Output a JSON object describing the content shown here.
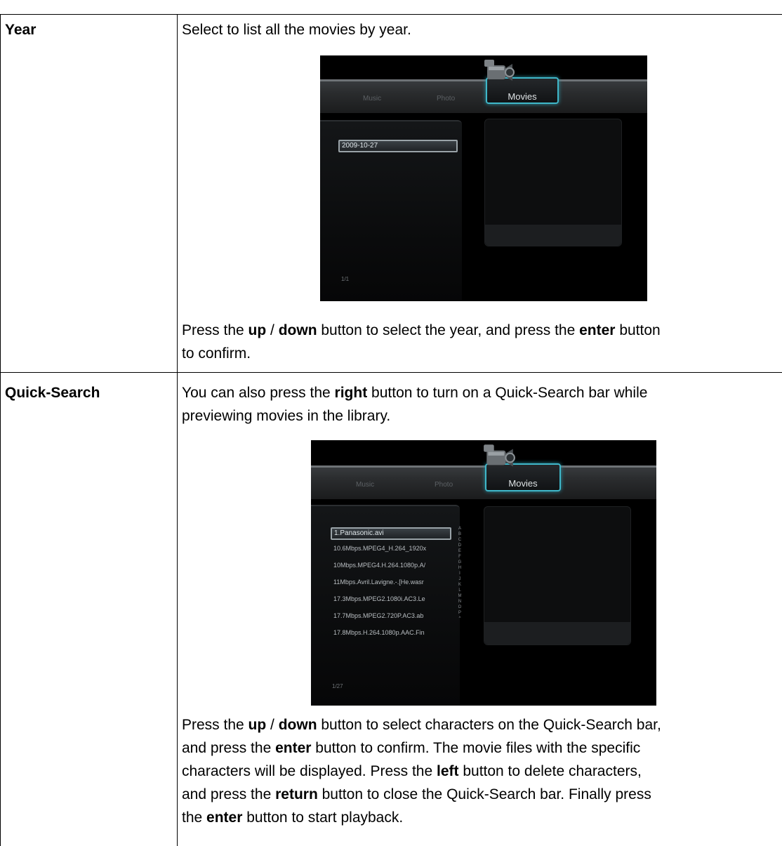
{
  "rows": [
    {
      "term": "Year",
      "intro": "Select to list all the movies by year.",
      "screen": {
        "tabs": [
          "Music",
          "Photo",
          "Movies"
        ],
        "items": [
          "2009-10-27"
        ],
        "pager": "1/1"
      },
      "instruction": [
        {
          "t": "Press the "
        },
        {
          "t": "up",
          "b": true
        },
        {
          "t": " / "
        },
        {
          "t": "down",
          "b": true
        },
        {
          "t": " button to select the year, and press the "
        },
        {
          "t": "enter",
          "b": true
        },
        {
          "t": " button"
        },
        {
          "t": "\n"
        },
        {
          "t": "to confirm."
        }
      ]
    },
    {
      "term": "Quick-Search",
      "intro": [
        {
          "t": "You can also press the "
        },
        {
          "t": "right",
          "b": true
        },
        {
          "t": " button to turn on a Quick-Search bar while"
        },
        {
          "t": "\n"
        },
        {
          "t": "previewing movies in the library."
        }
      ],
      "screen": {
        "tabs": [
          "Music",
          "Photo",
          "Movies"
        ],
        "items": [
          "1.Panasonic.avi",
          "10.6Mbps.MPEG4_H.264_1920x",
          "10Mbps.MPEG4.H.264.1080p.A/",
          "11Mbps.Avril.Lavigne.-.[He.wasr",
          "17.3Mbps.MPEG2.1080i.AC3.Le",
          "17.7Mbps.MPEG2.720P.AC3.ab",
          "17.8Mbps.H.264.1080p.AAC.Fin"
        ],
        "letters": [
          "A",
          "B",
          "C",
          "D",
          "E",
          "F",
          "G",
          "H",
          "I",
          "J",
          "K",
          "L",
          "M",
          "N",
          "O",
          "P",
          "^"
        ],
        "pager": "1/27"
      },
      "instruction": [
        {
          "t": "Press the "
        },
        {
          "t": "up",
          "b": true
        },
        {
          "t": " / "
        },
        {
          "t": "down",
          "b": true
        },
        {
          "t": " button to select characters on the Quick-Search bar,"
        },
        {
          "t": "\n"
        },
        {
          "t": "and press the "
        },
        {
          "t": "enter",
          "b": true
        },
        {
          "t": " button to confirm. The movie files with the specific"
        },
        {
          "t": "\n"
        },
        {
          "t": "characters will be displayed. Press the "
        },
        {
          "t": "left",
          "b": true
        },
        {
          "t": " button to delete characters,"
        },
        {
          "t": "\n"
        },
        {
          "t": "and press the "
        },
        {
          "t": "return",
          "b": true
        },
        {
          "t": " button to close the Quick-Search bar. Finally press"
        },
        {
          "t": "\n"
        },
        {
          "t": "the "
        },
        {
          "t": "enter",
          "b": true
        },
        {
          "t": " button to start playback."
        }
      ]
    }
  ],
  "colors": {
    "accent": "#3fb7c9",
    "text": "#000000",
    "background": "#ffffff"
  }
}
